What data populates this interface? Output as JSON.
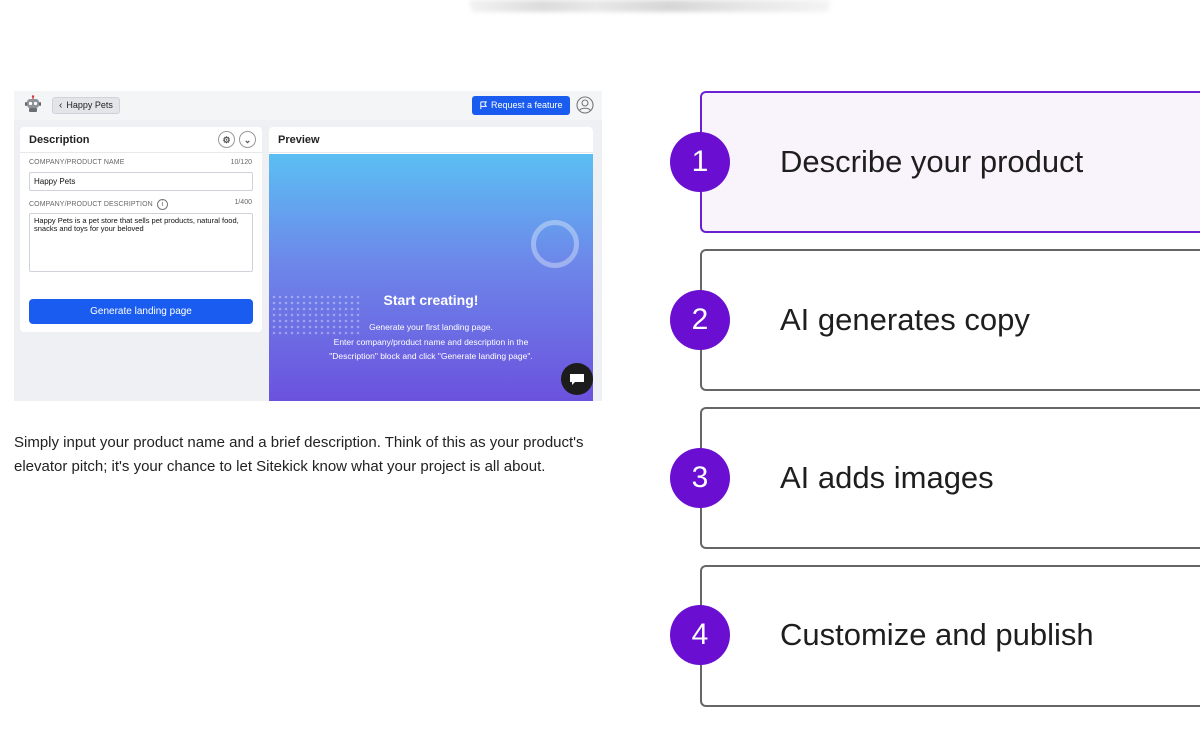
{
  "app": {
    "back_label": "Happy Pets",
    "request_label": "Request a feature",
    "description_panel": {
      "title": "Description",
      "name_label": "COMPANY/PRODUCT NAME",
      "name_count": "10/120",
      "name_value": "Happy Pets",
      "desc_label": "COMPANY/PRODUCT DESCRIPTION",
      "desc_count": "1/400",
      "desc_value": "Happy Pets is a pet store that sells pet products, natural food, snacks and toys for your beloved",
      "generate_label": "Generate landing page"
    },
    "preview_panel": {
      "title": "Preview",
      "heading": "Start creating!",
      "line1": "Generate your first landing page.",
      "line2": "Enter company/product name and description in the",
      "line3": "\"Description\" block and click \"Generate landing page\"."
    }
  },
  "caption": "Simply input your product name and a brief description. Think of this as your product's elevator pitch; it's your chance to let Sitekick know what your project is all about.",
  "steps": [
    {
      "number": "1",
      "label": "Describe your product",
      "active": true
    },
    {
      "number": "2",
      "label": "AI generates copy",
      "active": false
    },
    {
      "number": "3",
      "label": "AI adds images",
      "active": false
    },
    {
      "number": "4",
      "label": "Customize and publish",
      "active": false
    }
  ],
  "colors": {
    "accent": "#6a0fd2",
    "primary_button": "#1a5cf0"
  },
  "icons": [
    "robot-icon",
    "chevron-left-icon",
    "flag-icon",
    "user-icon",
    "settings-icon",
    "chevron-down-icon",
    "info-icon",
    "chat-icon"
  ]
}
